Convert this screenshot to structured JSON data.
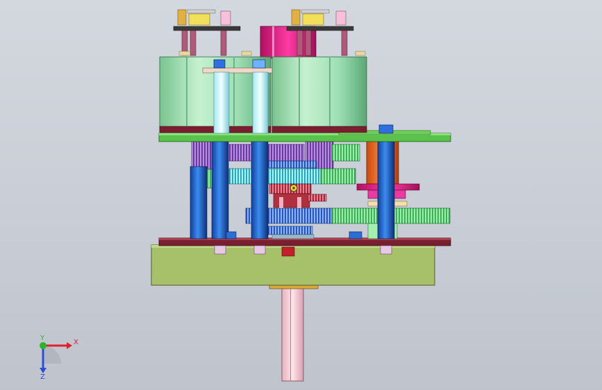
{
  "viewport": {
    "background": "#ccd1d8",
    "model": {
      "base_plate_color": "#a7c06a",
      "plate_color": "#7a1f2f",
      "green_plate_color": "#59c24a",
      "motor_body_color": "#9de0b4",
      "shaft_color": "#2a6fd6",
      "output_shaft_color": "#f1c9d2",
      "magenta_block_color": "#e0218a",
      "orange_spacer_color": "#f26b1d"
    }
  },
  "triad": {
    "x_label": "X",
    "y_label": "Y",
    "z_label": "Z",
    "x_color": "#e0202a",
    "y_color": "#2ab52a",
    "z_color": "#2a4fd6"
  }
}
